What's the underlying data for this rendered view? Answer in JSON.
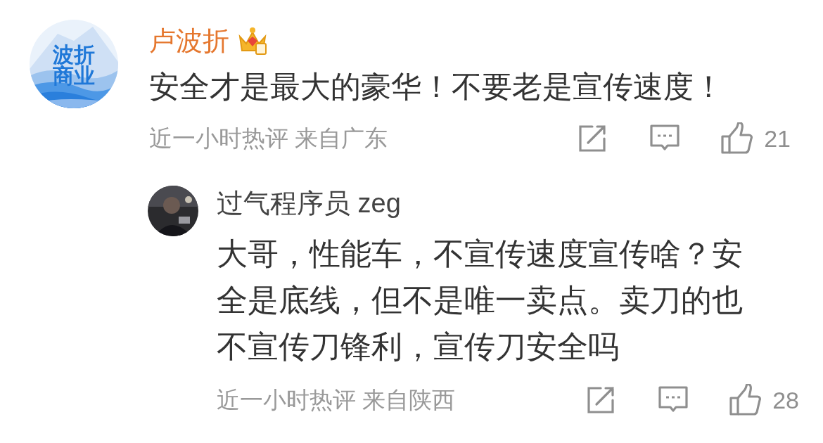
{
  "comment": {
    "avatar_text": [
      "波折",
      "商业"
    ],
    "author": "卢波折",
    "text": "安全才是最大的豪华！不要老是宣传速度！",
    "meta": "近一小时热评 来自广东",
    "likes": "21"
  },
  "reply": {
    "author": "过气程序员 zeg",
    "text": "大哥，性能车，不宣传速度宣传啥？安全是底线，但不是唯一卖点。卖刀的也不宣传刀锋利，宣传刀安全吗",
    "meta": "近一小时热评 来自陕西",
    "likes": "28"
  }
}
